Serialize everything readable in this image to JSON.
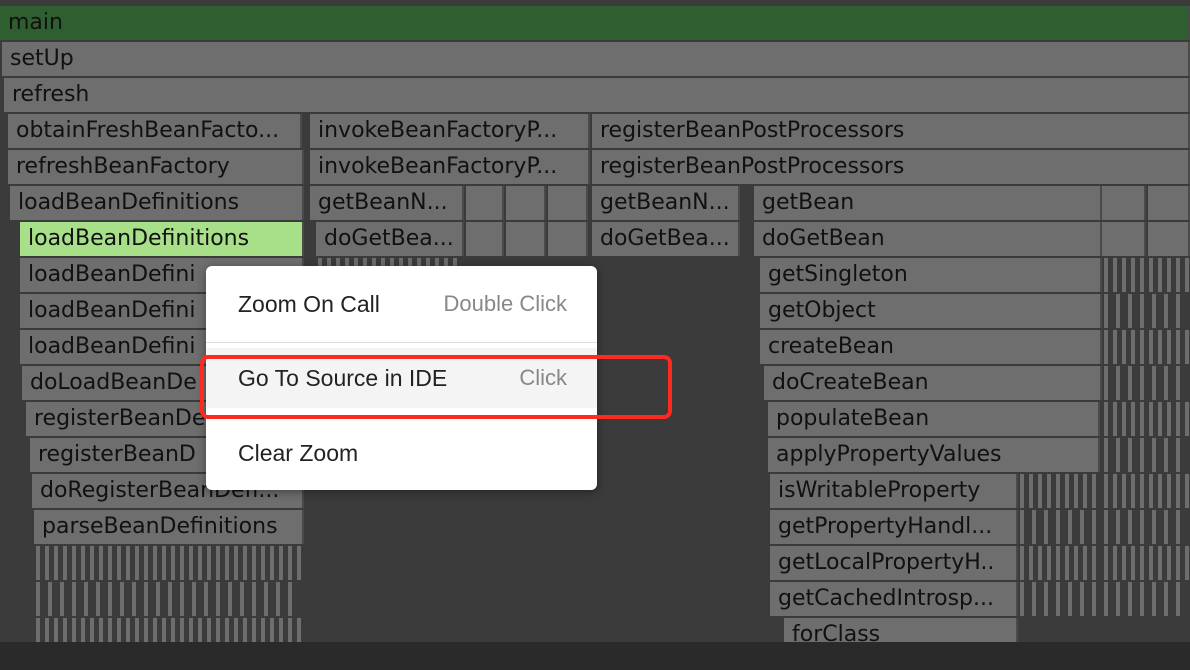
{
  "flamegraph": {
    "frames": [
      "main",
      "setUp",
      "refresh",
      "obtainFreshBeanFacto...",
      "invokeBeanFactoryP...",
      "registerBeanPostProcessors",
      "refreshBeanFactory",
      "invokeBeanFactoryP...",
      "registerBeanPostProcessors",
      "loadBeanDefinitions",
      "getBeanN...",
      "",
      "",
      "",
      "getBeanN...",
      "getBean",
      "",
      "",
      "loadBeanDefinitions",
      "doGetBea...",
      "",
      "",
      "",
      "doGetBea...",
      "doGetBean",
      "",
      "",
      "loadBeanDefini",
      "getSingleton",
      "loadBeanDefini",
      "getObject",
      "loadBeanDefini",
      "createBean",
      "doLoadBeanDe",
      "doCreateBean",
      "registerBeanDe",
      "populateBean",
      "registerBeanD",
      "applyPropertyValues",
      "doRegisterBeanDefi...",
      "isWritableProperty",
      "parseBeanDefinitions",
      "getPropertyHandl...",
      "getLocalPropertyH..",
      "getCachedIntrosp...",
      "forClass"
    ],
    "selected_frame": "loadBeanDefinitions",
    "colors": {
      "root": "#2f5e30",
      "selected": "#a8e08a",
      "frame": "#6e6e6e",
      "background": "#3b3b3b"
    }
  },
  "context_menu": {
    "items": [
      {
        "label": "Zoom On Call",
        "shortcut": "Double Click"
      },
      {
        "label": "Go To Source in IDE",
        "shortcut": "Click"
      },
      {
        "label": "Clear Zoom",
        "shortcut": ""
      }
    ],
    "highlighted": "Go To Source in IDE",
    "highlight_color": "#ff2a1f"
  }
}
